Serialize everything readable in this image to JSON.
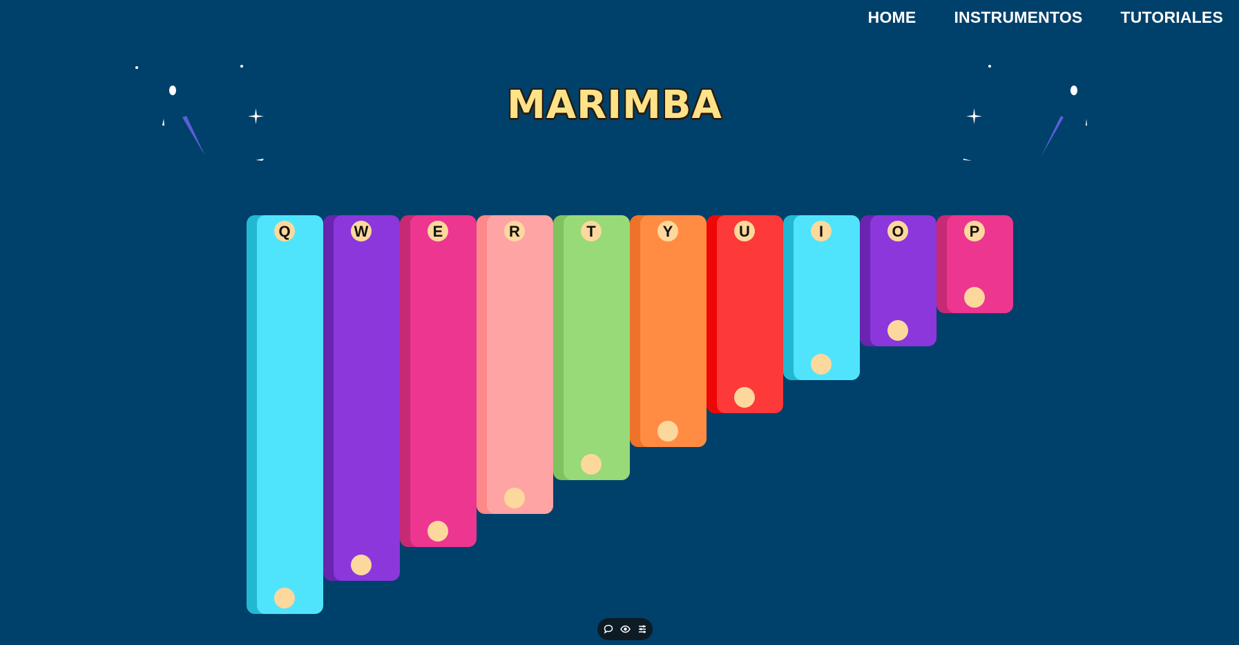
{
  "nav": {
    "items": [
      {
        "label": "HOME"
      },
      {
        "label": "INSTRUMENTOS"
      },
      {
        "label": "TUTORIALES"
      }
    ]
  },
  "title": "MARIMBA",
  "bars": [
    {
      "key": "Q",
      "face": "#50e4fc",
      "edge": "#22b8d2"
    },
    {
      "key": "W",
      "face": "#8b37db",
      "edge": "#6a24b0"
    },
    {
      "key": "E",
      "face": "#ec3690",
      "edge": "#c72a74"
    },
    {
      "key": "R",
      "face": "#fea4a4",
      "edge": "#fd8888"
    },
    {
      "key": "T",
      "face": "#98d978",
      "edge": "#7fc25f"
    },
    {
      "key": "Y",
      "face": "#ff8c42",
      "edge": "#ee7229"
    },
    {
      "key": "U",
      "face": "#fd3939",
      "edge": "#ee0707"
    },
    {
      "key": "I",
      "face": "#50e4fc",
      "edge": "#22b8d2"
    },
    {
      "key": "O",
      "face": "#8b37db",
      "edge": "#6a24b0"
    },
    {
      "key": "P",
      "face": "#ec3690",
      "edge": "#c72a74"
    }
  ],
  "colors": {
    "background": "#00416b",
    "title": "#fee28a",
    "key_badge": "#fdd89c",
    "star_accent": "#5b5fd6"
  },
  "toolbar": {
    "icons": [
      "chat-icon",
      "eye-icon",
      "sliders-icon"
    ]
  }
}
